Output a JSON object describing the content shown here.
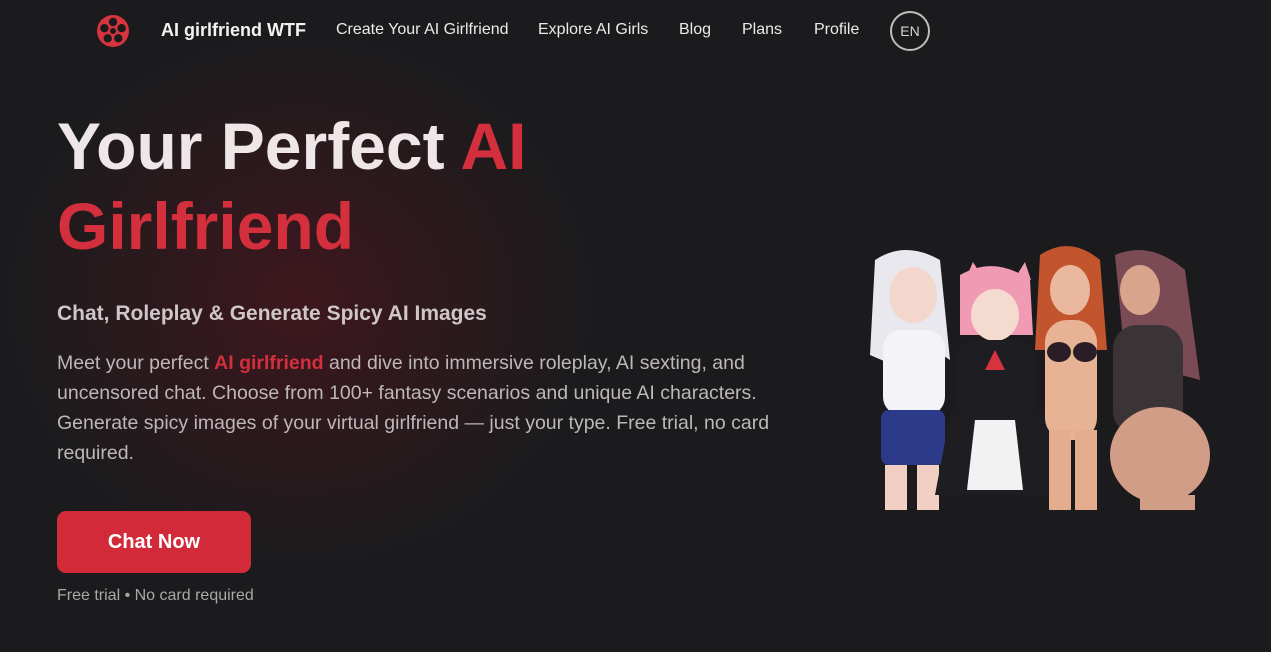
{
  "nav": {
    "brand": "AI girlfriend WTF",
    "links": [
      "Create Your AI Girlfriend",
      "Explore AI Girls",
      "Blog",
      "Plans",
      "Profile"
    ],
    "language": "EN"
  },
  "hero": {
    "title_part1": "Your Perfect ",
    "title_accent1": "AI",
    "title_accent2": "Girlfriend",
    "subtitle": "Chat, Roleplay & Generate Spicy AI Images",
    "desc_before": "Meet your perfect ",
    "desc_highlight": "AI girlfriend",
    "desc_after": " and dive into immersive roleplay, AI sexting, and uncensored chat. Choose from 100+ fantasy scenarios and unique AI characters. Generate spicy images of your virtual girlfriend — just your type. Free trial, no card required.",
    "cta_label": "Chat Now",
    "cta_note": "Free trial • No card required"
  },
  "colors": {
    "accent": "#d32f3d",
    "background": "#1b1b1d"
  },
  "icons": {
    "logo": "film-reel-icon"
  }
}
